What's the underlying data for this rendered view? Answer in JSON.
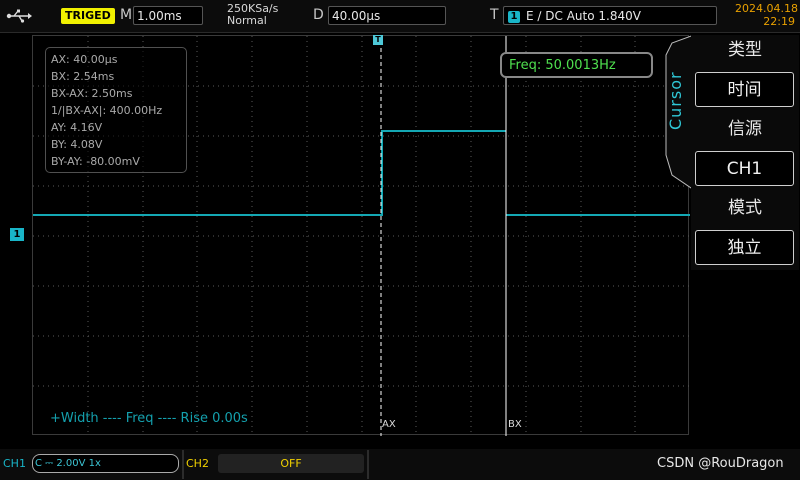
{
  "top": {
    "status": "TRIGED",
    "m_label": "M",
    "timebase": "1.00ms",
    "sample_rate": "250KSa/s",
    "acq_mode": "Normal",
    "d_label": "D",
    "delay": "40.00µs",
    "t_label": "T",
    "trigger_channel": "1",
    "trigger_text": "E ∕ DC Auto 1.840V",
    "date": "2024.04.18",
    "time": "22:19"
  },
  "readout": {
    "ax": "AX:  40.00µs",
    "bx": "BX:  2.54ms",
    "bx_ax": "BX-AX:  2.50ms",
    "inv": "1/|BX-AX|:  400.00Hz",
    "ay": "AY:  4.16V",
    "by": "BY:  4.08V",
    "by_ay": "BY-AY:  -80.00mV"
  },
  "freq": "Freq: 50.0013Hz",
  "measure_line": "+Width ----   Freq ----   Rise 0.00s",
  "cursor_labels": {
    "ax": "AX",
    "bx": "BX"
  },
  "markers": {
    "ch1": "1",
    "trigger": "T"
  },
  "menu": {
    "tab": "Cursor",
    "items": [
      {
        "title": "类型",
        "value": "时间"
      },
      {
        "title": "信源",
        "value": "CH1"
      },
      {
        "title": "模式",
        "value": "独立"
      }
    ]
  },
  "bottom": {
    "ch1_label": "CH1",
    "ch1_setting": "C ⎓ 2.00V 1x",
    "ch2_label": "CH2",
    "ch2_setting": "OFF",
    "watermark": "CSDN @RouDragon"
  },
  "colors": {
    "ch1": "#19b5c8",
    "trace": "#14a8b4",
    "triged_bg": "#f0f000",
    "freq_text": "#4fe04f",
    "date_text": "#e8a000"
  }
}
